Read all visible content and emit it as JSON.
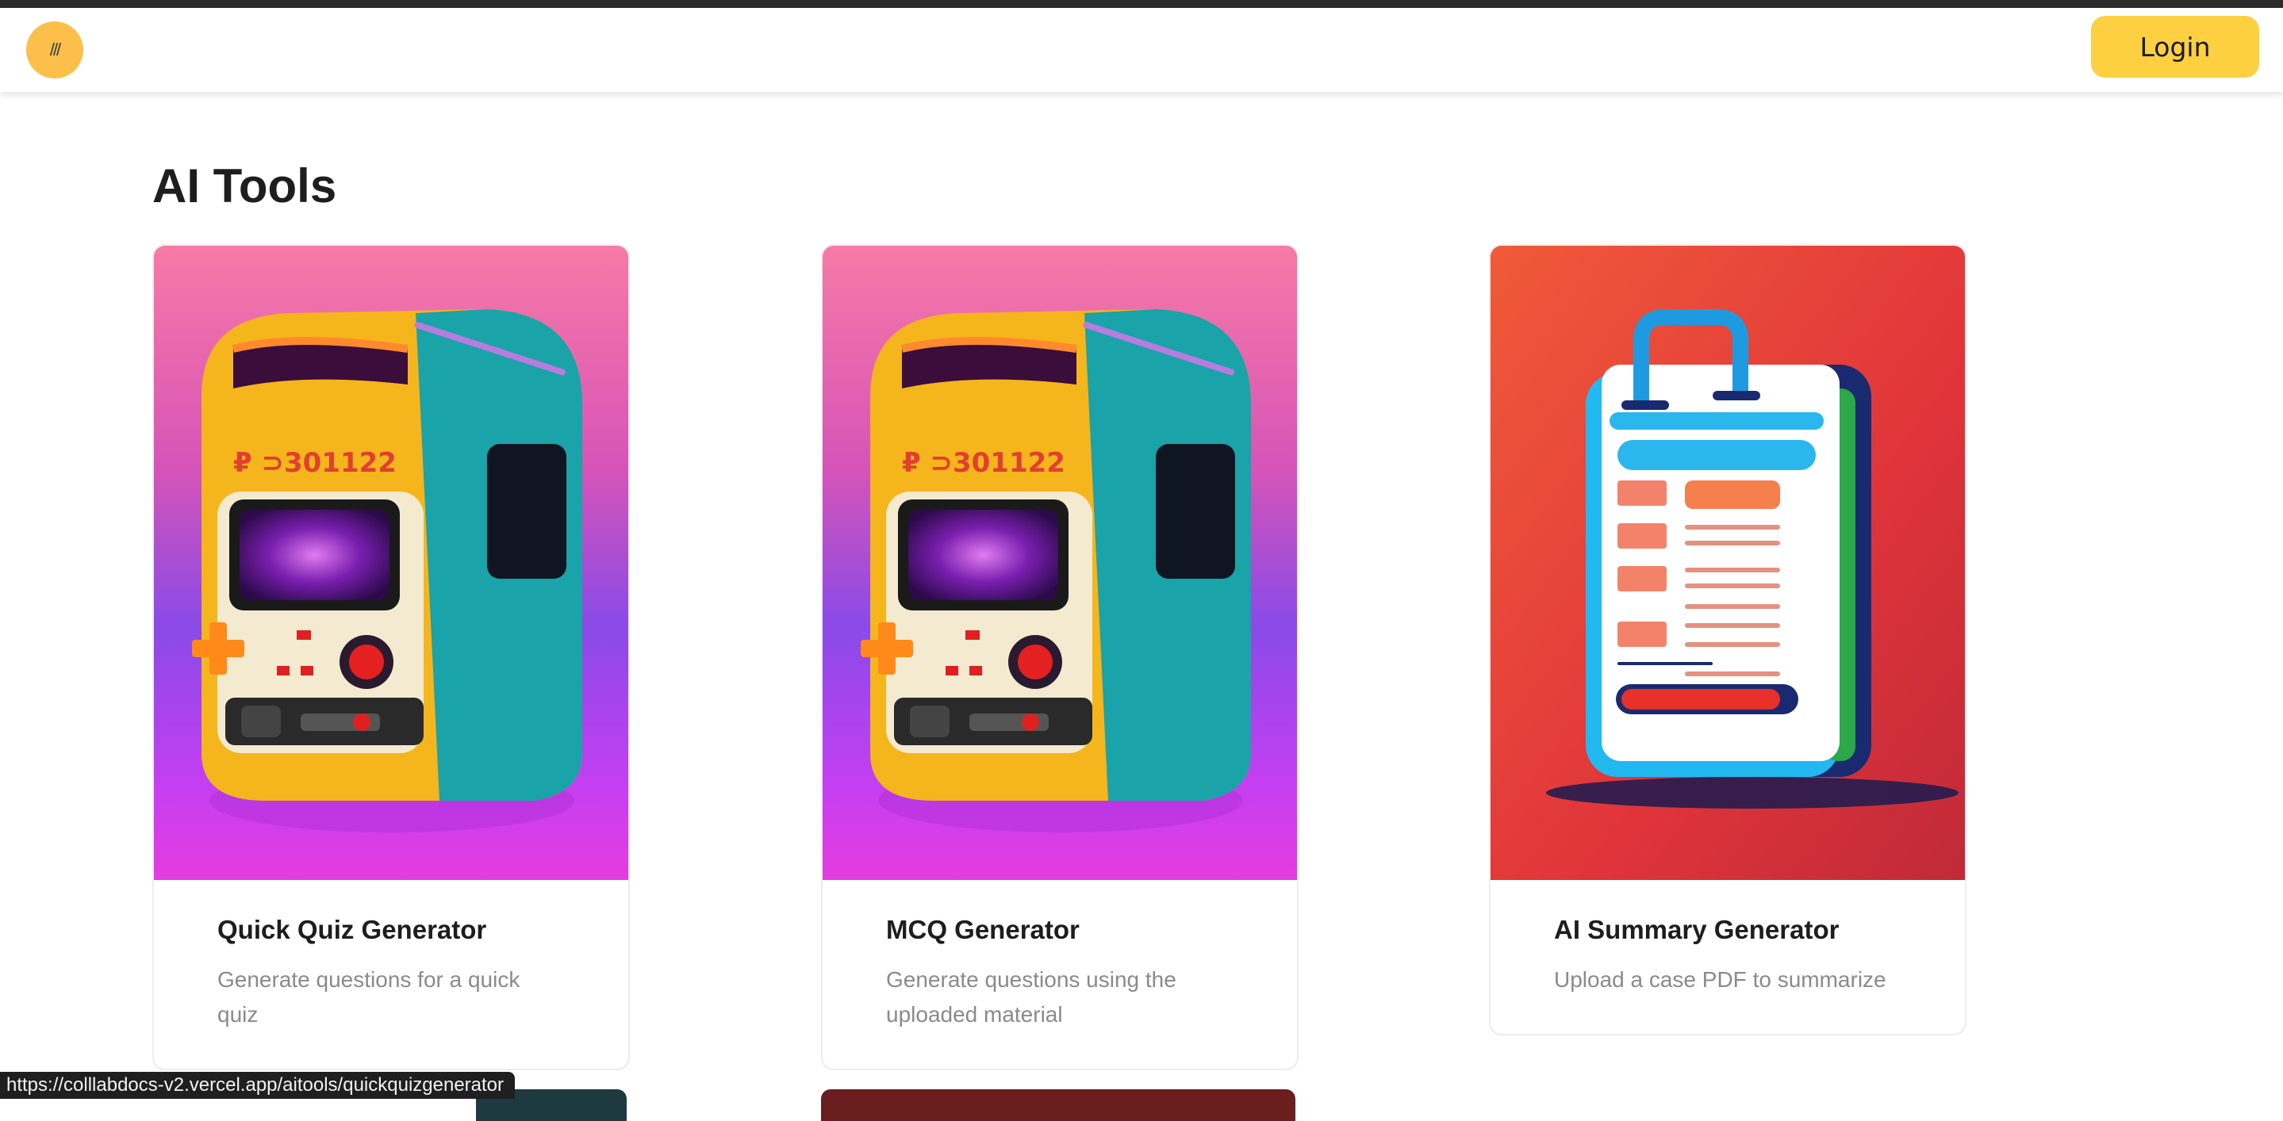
{
  "navbar": {
    "menu_label": "///",
    "login_label": "Login"
  },
  "page": {
    "title": "AI Tools"
  },
  "cards": [
    {
      "title": "Quick Quiz Generator",
      "description": "Generate questions for a quick quiz",
      "display_code": "₽ ⊃301122",
      "image": "retro-quiz-machine"
    },
    {
      "title": "MCQ Generator",
      "description": "Generate questions using the uploaded material",
      "display_code": "₽ ⊃301122",
      "image": "retro-quiz-machine"
    },
    {
      "title": "AI Summary Generator",
      "description": "Upload a case PDF to summarize",
      "image": "clipboard-document"
    }
  ],
  "status_bar": {
    "url": "https://colllabdocs-v2.vercel.app/aitools/quickquizgenerator"
  },
  "colors": {
    "accent_yellow": "#fcd040",
    "menu_orange": "#fbbf4a",
    "card_border": "#ececec"
  }
}
